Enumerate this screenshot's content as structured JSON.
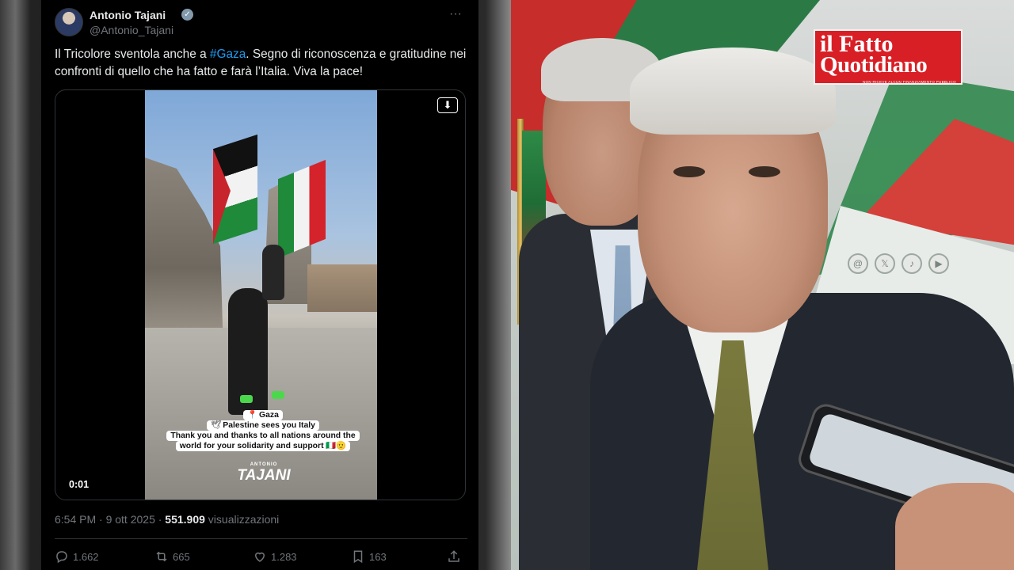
{
  "tweet": {
    "author_name": "Antonio Tajani",
    "author_handle": "@Antonio_Tajani",
    "text_part1": "Il Tricolore sventola anche a ",
    "hashtag": "#Gaza",
    "text_part2": ". Segno di riconoscenza e gratitudine nei confronti di quello che ha fatto e farà l’Italia. Viva la pace!",
    "video": {
      "time": "0:01",
      "caption_location": "Gaza",
      "caption_line2": "Palestine sees you Italy",
      "caption_line3": "Thank you and thanks to all nations around the",
      "caption_line4": "world for your solidarity and support 🇮🇹🫡",
      "brand_top": "ANTONIO",
      "brand_name": "TAJANI"
    },
    "timestamp": "6:54 PM · 9 ott 2025 · ",
    "views_count": "551.909",
    "views_label": " visualizzazioni",
    "actions": {
      "replies": "1.662",
      "reposts": "665",
      "likes": "1.283",
      "bookmarks": "163"
    }
  },
  "photo": {
    "logo_line1": "il Fatto",
    "logo_line2": "Quotidiano",
    "logo_tagline": "NON RICEVE ALCUN FINANZIAMENTO PUBBLICO"
  },
  "icons": [
    "verified-icon",
    "more-icon",
    "download-icon",
    "reply-icon",
    "repost-icon",
    "like-icon",
    "bookmark-icon",
    "share-icon",
    "pin-icon",
    "dove-icon"
  ],
  "colors": {
    "background": "#000000",
    "text": "#e7e9ea",
    "muted": "#71767b",
    "link": "#1d9bf0",
    "logo_red": "#d91f26"
  }
}
